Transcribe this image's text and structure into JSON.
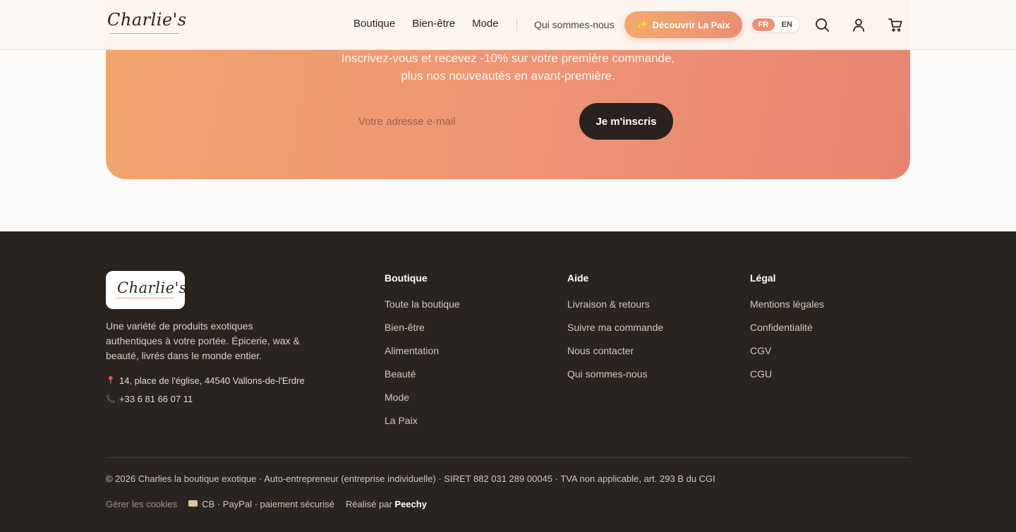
{
  "header": {
    "logo_text": "Charlie's",
    "nav": [
      "Boutique",
      "Bien-être",
      "Mode"
    ],
    "about_label": "Qui sommes-nous",
    "cta_label": "Découvrir La Paix",
    "cta_icon": "sparkle-icon",
    "languages": [
      "FR",
      "EN"
    ],
    "active_language": "FR",
    "icons": [
      "search-icon",
      "user-icon",
      "cart-icon"
    ]
  },
  "newsletter": {
    "text_line1": "Inscrivez-vous et recevez -10% sur votre première commande,",
    "text_line2": "plus nos nouveautés en avant-première.",
    "email_placeholder": "Votre adresse e-mail",
    "submit_label": "Je m'inscris"
  },
  "footer": {
    "logo_text": "Charlie's",
    "description": "Une variété de produits exotiques authentiques à votre portée. Épicerie, wax & beauté, livrés dans le monde entier.",
    "address": "14, place de l'église, 44540 Vallons-de-l'Erdre",
    "phone": "+33 6 81 66 07 11",
    "columns": [
      {
        "title": "Boutique",
        "links": [
          "Toute la boutique",
          "Bien-être",
          "Alimentation",
          "Beauté",
          "Mode",
          "La Paix"
        ]
      },
      {
        "title": "Aide",
        "links": [
          "Livraison & retours",
          "Suivre ma commande",
          "Nous contacter",
          "Qui sommes-nous"
        ]
      },
      {
        "title": "Légal",
        "links": [
          "Mentions légales",
          "Confidentialité",
          "CGV",
          "CGU"
        ]
      }
    ],
    "legal_line": "© 2026 Charlies la boutique exotique · Auto-entrepreneur (entreprise individuelle) · SIRET 882 031 289 00045 · TVA non applicable, art. 293 B du CGI",
    "cookies_label": "Gérer les cookies",
    "payment_text": "CB · PayPal · paiement sécurisé",
    "made_by_prefix": "Réalisé par",
    "made_by_name": "Peechy"
  },
  "colors": {
    "accent": "#ee8f70",
    "footer_bg": "#2a2421",
    "dark_button": "#2a2220"
  }
}
